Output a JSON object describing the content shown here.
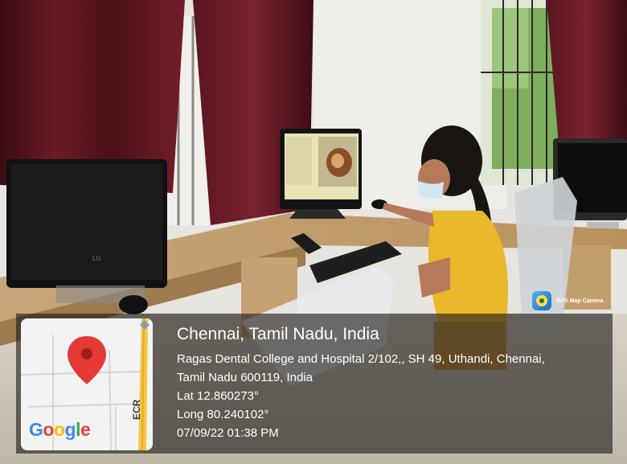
{
  "location": {
    "city_line": "Chennai, Tamil Nadu, India",
    "address_line1": "Ragas Dental College and Hospital 2/102,, SH 49, Uthandi, Chennai,",
    "address_line2": "Tamil Nadu 600119, India",
    "latitude": "Lat 12.860273°",
    "longitude": "Long 80.240102°",
    "datetime": "07/09/22 01:38 PM"
  },
  "map": {
    "logo_text": "Google",
    "road_label": "ECR",
    "pin_color": "#e53935",
    "road_color": "#f5c542"
  },
  "app_badge": {
    "name": "GPS Map Camera",
    "icon": "camera-lens-icon"
  },
  "scene": {
    "monitor_brand": "LG"
  }
}
